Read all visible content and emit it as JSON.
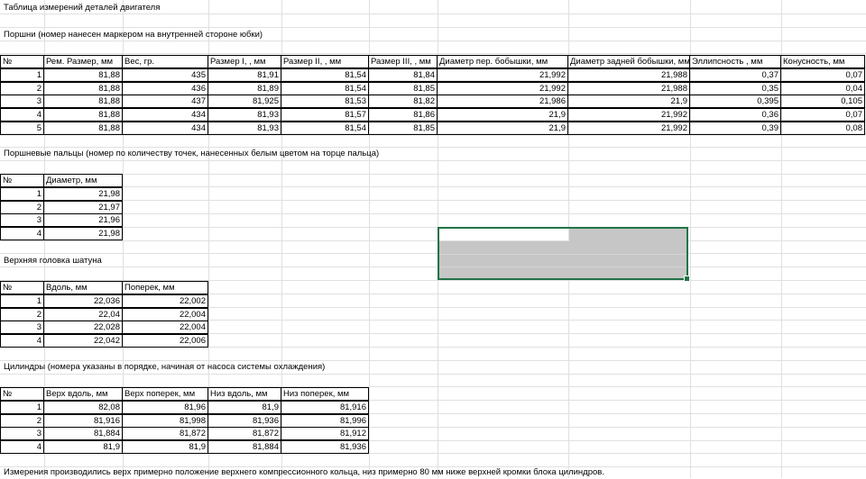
{
  "title": "Таблица измерений деталей двигателя",
  "pistons": {
    "caption": "Поршни (номер нанесен маркером на внутренней стороне юбки)",
    "headers": [
      "№",
      "Рем. Размер, мм",
      "Вес, гр.",
      "Размер I, , мм",
      "Размер II, , мм",
      "Размер III, , мм",
      "Диаметр пер. бобышки, мм",
      "Диаметр задней бобышки, мм",
      "Эллипсность , мм",
      "Конусность, мм"
    ],
    "rows": [
      [
        "1",
        "81,88",
        "435",
        "81,91",
        "81,54",
        "81,84",
        "21,992",
        "21,988",
        "0,37",
        "0,07"
      ],
      [
        "2",
        "81,88",
        "436",
        "81,89",
        "81,54",
        "81,85",
        "21,992",
        "21,988",
        "0,35",
        "0,04"
      ],
      [
        "3",
        "81,88",
        "437",
        "81,925",
        "81,53",
        "81,82",
        "21,986",
        "21,9",
        "0,395",
        "0,105"
      ],
      [
        "4",
        "81,88",
        "434",
        "81,93",
        "81,57",
        "81,86",
        "21,9",
        "21,992",
        "0,36",
        "0,07"
      ],
      [
        "5",
        "81,88",
        "434",
        "81,93",
        "81,54",
        "81,85",
        "21,9",
        "21,992",
        "0,39",
        "0,08"
      ]
    ]
  },
  "pins": {
    "caption": "Поршневые пальцы (номер по количеству точек, нанесенных белым цветом на торце пальца)",
    "headers": [
      "№",
      "Диаметр, мм"
    ],
    "rows": [
      [
        "1",
        "21,98"
      ],
      [
        "2",
        "21,97"
      ],
      [
        "3",
        "21,96"
      ],
      [
        "4",
        "21,98"
      ]
    ]
  },
  "rods": {
    "caption": "Верхняя головка шатуна",
    "headers": [
      "№",
      "Вдоль, мм",
      "Поперек, мм"
    ],
    "rows": [
      [
        "1",
        "22,036",
        "22,002"
      ],
      [
        "2",
        "22,04",
        "22,004"
      ],
      [
        "3",
        "22,028",
        "22,004"
      ],
      [
        "4",
        "22,042",
        "22,006"
      ]
    ]
  },
  "cylinders": {
    "caption": "Цилиндры (номера указаны в порядке, начиная от насоса системы охлаждения)",
    "headers": [
      "№",
      "Верх вдоль, мм",
      "Верх поперек, мм",
      "Низ вдоль, мм",
      "Низ поперек, мм"
    ],
    "rows": [
      [
        "1",
        "82,08",
        "81,96",
        "81,9",
        "81,916"
      ],
      [
        "2",
        "81,916",
        "81,998",
        "81,936",
        "81,996"
      ],
      [
        "3",
        "81,884",
        "81,872",
        "81,872",
        "81,912"
      ],
      [
        "4",
        "81,9",
        "81,9",
        "81,884",
        "81,936"
      ]
    ]
  },
  "footnote": "Измерения производились верх примерно положение верхнего компрессионного кольца, низ примерно 80 мм ниже верхней кромки блока цилиндров.",
  "colors": {
    "selection_border": "#217346",
    "selection_fill": "#c6c6c6",
    "grid": "#e0e0e0"
  }
}
